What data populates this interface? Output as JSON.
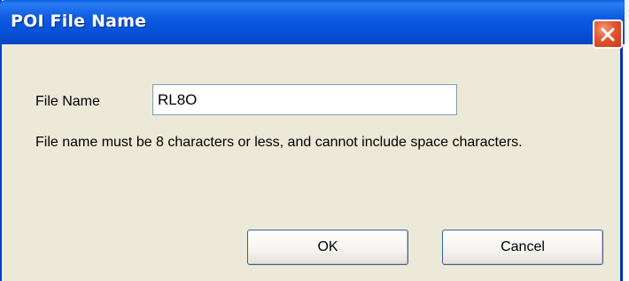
{
  "window": {
    "title": "POI File Name",
    "close_icon": "close-icon"
  },
  "form": {
    "label": "File Name",
    "value": "RL8O"
  },
  "help_text": "File name must be 8 characters or less, and cannot include space characters.",
  "buttons": {
    "ok": "OK",
    "cancel": "Cancel"
  },
  "colors": {
    "titlebar": "#0652d9",
    "close": "#e2552f",
    "face": "#ece9d8"
  }
}
